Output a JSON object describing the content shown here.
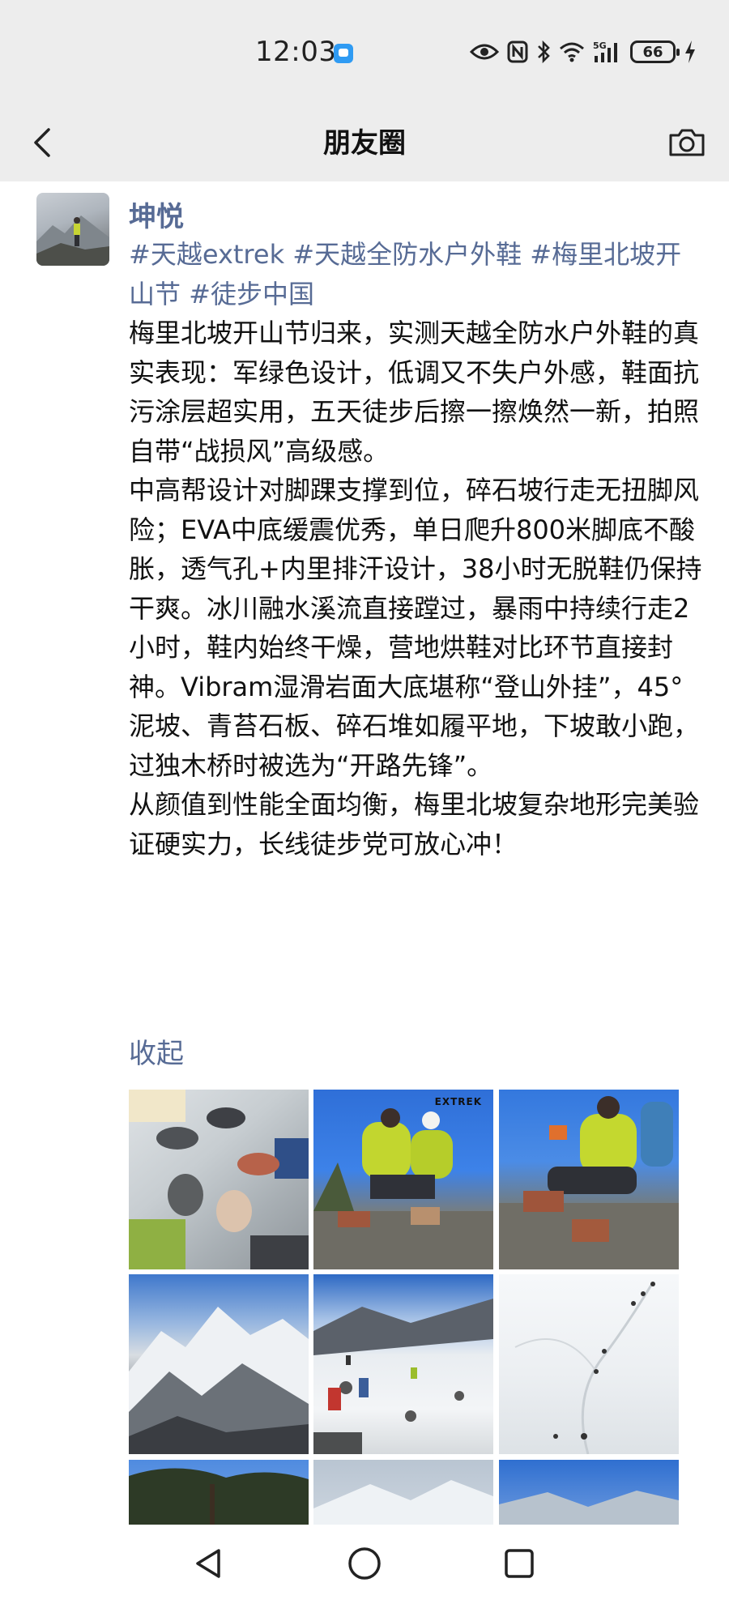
{
  "status_bar": {
    "time": "12:03",
    "network": "5G",
    "battery": "66"
  },
  "header": {
    "title": "朋友圈"
  },
  "post": {
    "author": "坤悦",
    "hashtags": "#天越extrek #天越全防水户外鞋 #梅里北坡开山节 #徒步中国",
    "paragraphs": [
      "梅里北坡开山节归来，实测天越全防水户外鞋的真实表现：军绿色设计，低调又不失户外感，鞋面抗污涂层超实用，五天徒步后擦一擦焕然一新，拍照自带“战损风”高级感。",
      "中高帮设计对脚踝支撑到位，碎石坡行走无扭脚风险；EVA中底缓震优秀，单日爬升800米脚底不酸胀，透气孔+内里排汗设计，38小时无脱鞋仍保持干爽。冰川融水溪流直接蹚过，暴雨中持续行走2小时，鞋内始终干燥，营地烘鞋对比环节直接封神。Vibram湿滑岩面大底堪称“登山外挂”，45°泥坡、青苔石板、碎石堆如履平地，下坡敢小跑，过独木桥时被选为“开路先锋”。",
      "从颜值到性能全面均衡，梅里北坡复杂地形完美验证硬实力，长线徒步党可放心冲！"
    ],
    "collapse_label": "收起",
    "photo_logo": "EXTREK",
    "photos": [
      {
        "name": "photo-hiking-boots-circle"
      },
      {
        "name": "photo-hikers-binoculars"
      },
      {
        "name": "photo-hiker-sitting-rock"
      },
      {
        "name": "photo-snow-mountain-range"
      },
      {
        "name": "photo-snow-slope-hikers"
      },
      {
        "name": "photo-snowfield-trail"
      },
      {
        "name": "photo-pine-trees-sky"
      },
      {
        "name": "photo-cloudy-peak"
      },
      {
        "name": "photo-blue-sky-ridge"
      }
    ]
  },
  "icons": {
    "back": "chevron-left-icon",
    "camera": "camera-icon",
    "nav_back": "triangle-back-icon",
    "nav_home": "circle-home-icon",
    "nav_recent": "square-recent-icon"
  },
  "colors": {
    "link": "#576b95",
    "header_bg": "#ededed",
    "text": "#111111"
  }
}
